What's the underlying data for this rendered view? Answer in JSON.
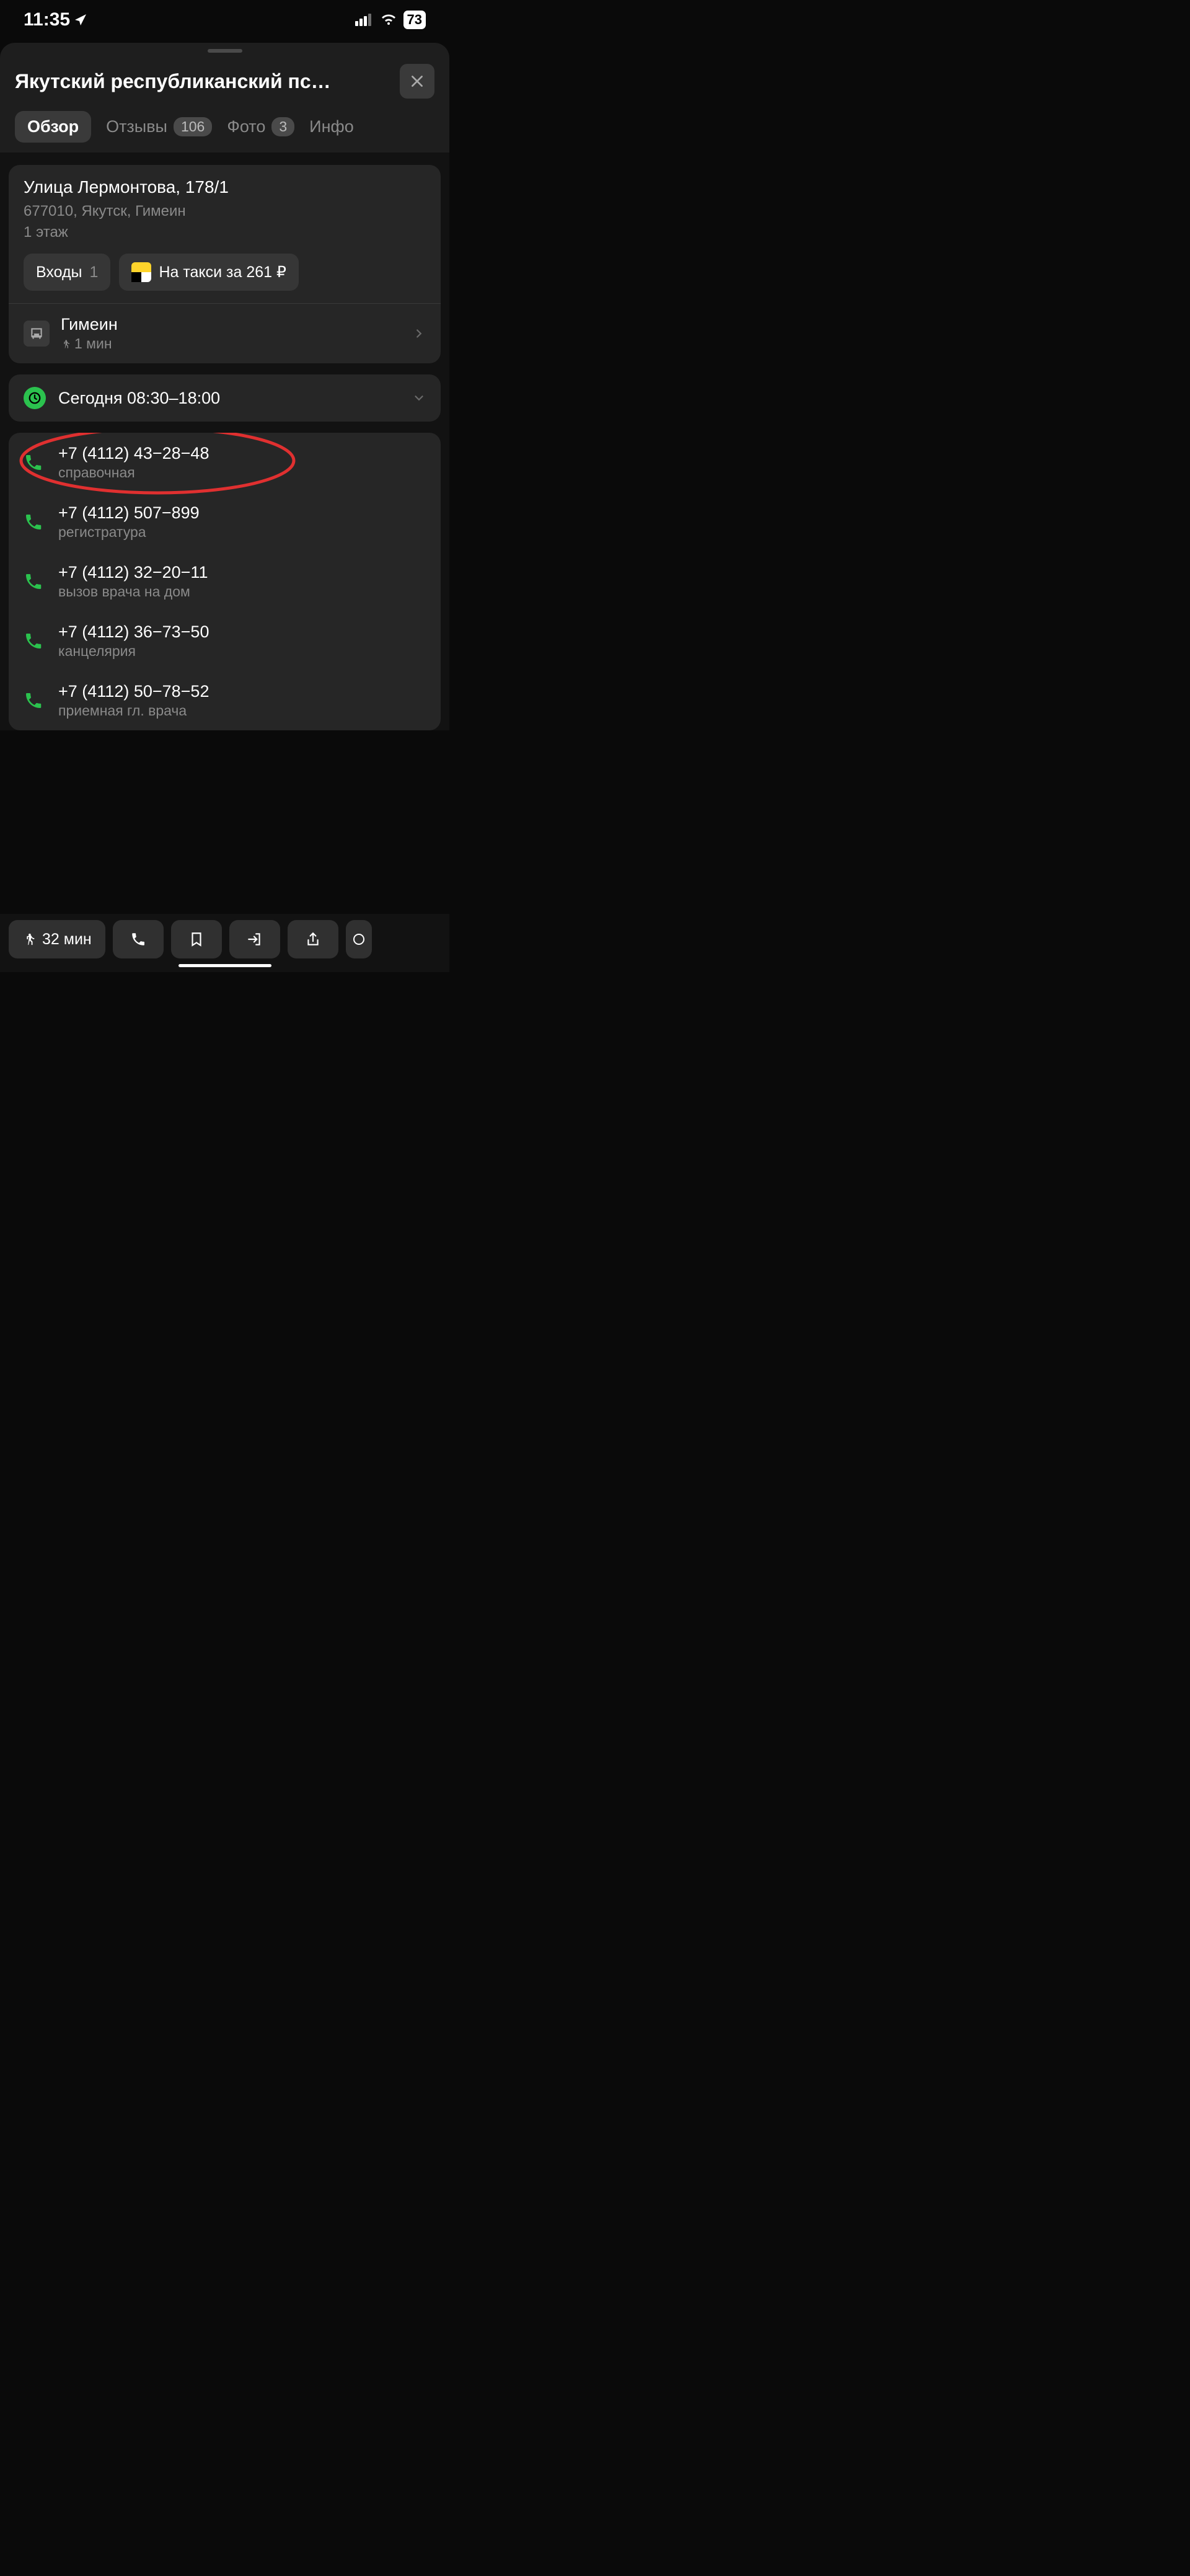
{
  "status_bar": {
    "time": "11:35",
    "battery": "73"
  },
  "header": {
    "title": "Якутский республиканский пс…"
  },
  "tabs": {
    "overview": "Обзор",
    "reviews": "Отзывы",
    "reviews_count": "106",
    "photo": "Фото",
    "photo_count": "3",
    "info": "Инфо"
  },
  "address": {
    "street": "Улица Лермонтова, 178/1",
    "city": "677010, Якутск, Гимеин",
    "floor": "1 этаж",
    "entrances_label": "Входы",
    "entrances_count": "1",
    "taxi_label": "На такси за 261 ₽"
  },
  "transit": {
    "stop": "Гимеин",
    "walk": "1 мин"
  },
  "hours": {
    "today": "Сегодня 08:30–18:00"
  },
  "phones": [
    {
      "number": "+7 (4112) 43−28−48",
      "label": "справочная"
    },
    {
      "number": "+7 (4112) 507−899",
      "label": "регистратура"
    },
    {
      "number": "+7 (4112) 32−20−11",
      "label": "вызов врача на дом"
    },
    {
      "number": "+7 (4112) 36−73−50",
      "label": "канцелярия"
    },
    {
      "number": "+7 (4112) 50−78−52",
      "label": "приемная гл. врача"
    }
  ],
  "bottom": {
    "walk_time": "32 мин"
  }
}
